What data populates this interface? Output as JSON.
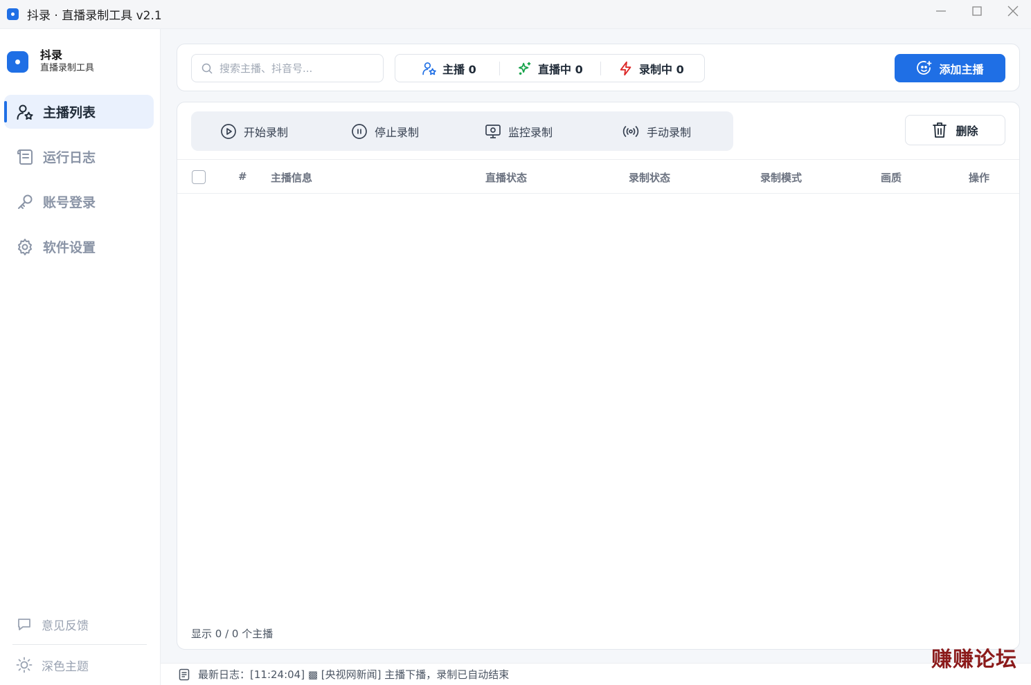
{
  "window": {
    "title": "抖录 · 直播录制工具 v2.1",
    "minimize": "—",
    "maximize": "☐",
    "close": "✕"
  },
  "brand": {
    "name": "抖录",
    "subtitle": "直播录制工具"
  },
  "sidebar": {
    "items": [
      {
        "label": "主播列表",
        "icon": "user-star-icon",
        "active": true
      },
      {
        "label": "运行日志",
        "icon": "scroll-icon",
        "active": false
      },
      {
        "label": "账号登录",
        "icon": "key-icon",
        "active": false
      },
      {
        "label": "软件设置",
        "icon": "gear-icon",
        "active": false
      }
    ],
    "bottom": [
      {
        "label": "意见反馈",
        "icon": "chat-icon"
      },
      {
        "label": "深色主题",
        "icon": "sun-icon"
      }
    ]
  },
  "search": {
    "placeholder": "搜索主播、抖音号..."
  },
  "stats": {
    "streamers": "主播 0",
    "live": "直播中 0",
    "recording": "录制中 0"
  },
  "add_button": "添加主播",
  "actions": {
    "start": "开始录制",
    "stop": "停止录制",
    "monitor": "监控录制",
    "manual": "手动录制",
    "delete": "删除"
  },
  "table": {
    "columns": [
      "#",
      "主播信息",
      "直播状态",
      "录制状态",
      "录制模式",
      "画质",
      "操作"
    ],
    "rows": []
  },
  "footer_count": "显示 0 / 0 个主播",
  "status_log": "最新日志：[11:24:04] ▩ [央视网新闻] 主播下播，录制已自动结束",
  "watermark": "赚赚论坛",
  "colors": {
    "accent": "#1f6fe5",
    "live": "#16a34a",
    "recording": "#dc2626"
  }
}
